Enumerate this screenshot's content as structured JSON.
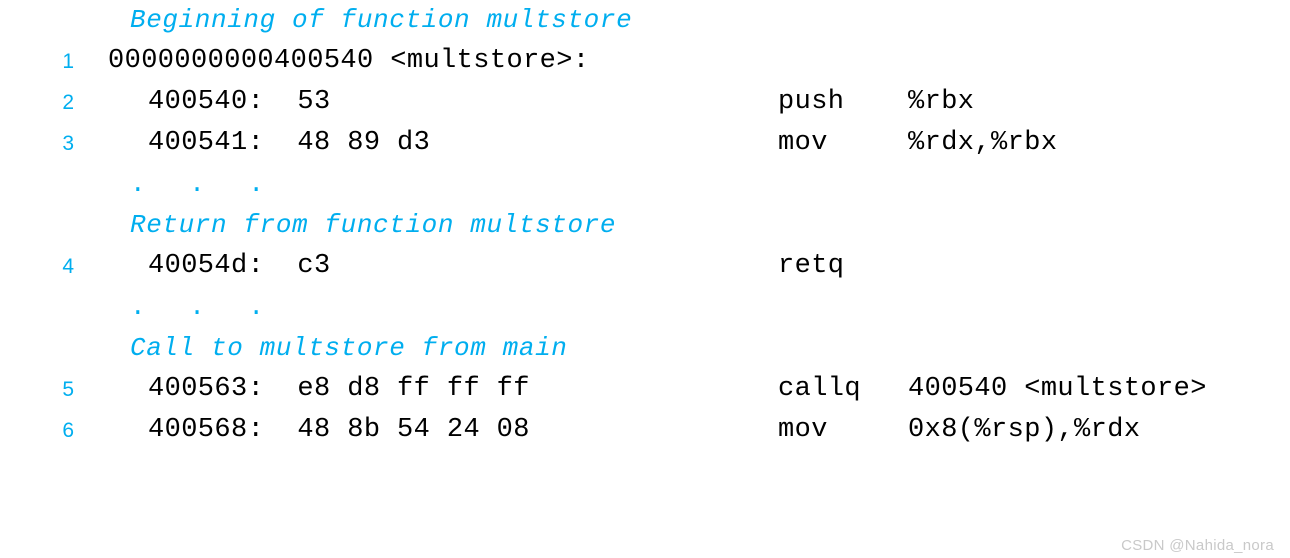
{
  "document": {
    "kind": "disassembly-listing",
    "background_color": "#ffffff",
    "code_color": "#000000",
    "comment_color": "#00AEEF",
    "line_number_color": "#00AEEF",
    "watermark": "CSDN @Nahida_nora"
  },
  "rows": [
    {
      "type": "comment",
      "line_number": "",
      "text": "Beginning of function multstore"
    },
    {
      "type": "code",
      "line_number": "1",
      "indent": false,
      "address": "0000000000400540 <multstore>:",
      "mnemonic": "",
      "operands": ""
    },
    {
      "type": "code",
      "line_number": "2",
      "indent": true,
      "address": "400540:  53",
      "mnemonic": "push",
      "operands": "%rbx"
    },
    {
      "type": "code",
      "line_number": "3",
      "indent": true,
      "address": "400541:  48 89 d3",
      "mnemonic": "mov",
      "operands": "%rdx,%rbx"
    },
    {
      "type": "ellipsis",
      "line_number": "",
      "text": ". . ."
    },
    {
      "type": "comment",
      "line_number": "",
      "text": "Return from function multstore"
    },
    {
      "type": "code",
      "line_number": "4",
      "indent": true,
      "address": "40054d:  c3",
      "mnemonic": "retq",
      "operands": ""
    },
    {
      "type": "ellipsis",
      "line_number": "",
      "text": ". . ."
    },
    {
      "type": "comment",
      "line_number": "",
      "text": "Call to multstore from main"
    },
    {
      "type": "code",
      "line_number": "5",
      "indent": true,
      "address": "400563:  e8 d8 ff ff ff",
      "mnemonic": "callq",
      "operands": "400540 <multstore>"
    },
    {
      "type": "code",
      "line_number": "6",
      "indent": true,
      "address": "400568:  48 8b 54 24 08",
      "mnemonic": "mov",
      "operands": "0x8(%rsp),%rdx"
    }
  ]
}
